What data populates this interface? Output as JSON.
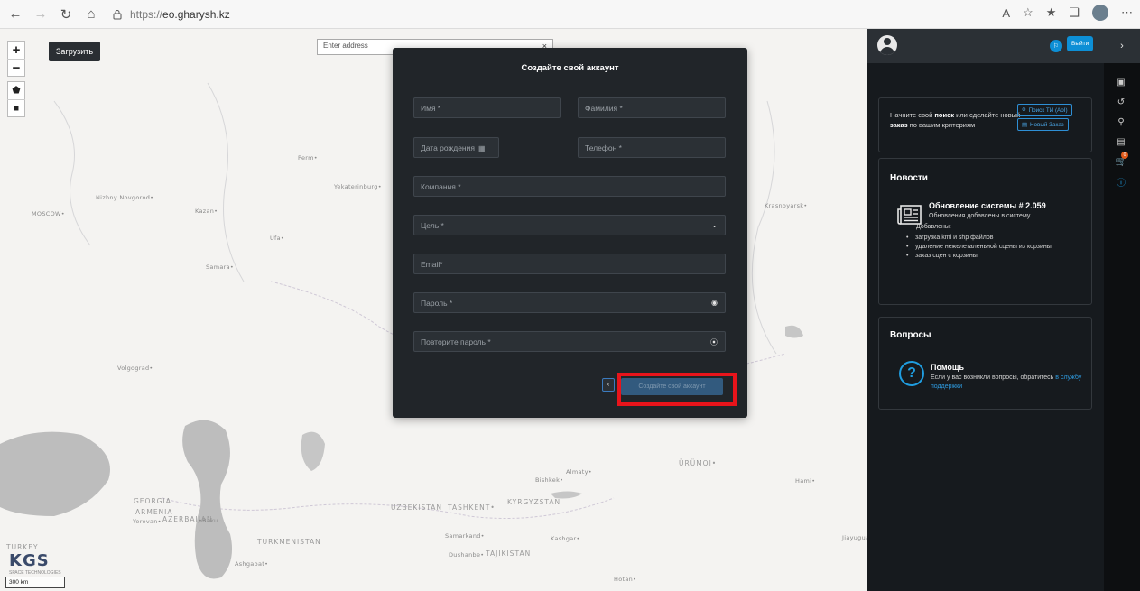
{
  "browser": {
    "url_scheme": "https://",
    "url_host": "eo.gharysh.kz"
  },
  "map": {
    "upload_label": "Загрузить",
    "address_placeholder": "Enter address",
    "scale_label": "300 km",
    "logo_text": "KGS",
    "logo_sub": "SPACE TECHNOLOGIES",
    "labels": {
      "moscow": "MOSCOW•",
      "nizhny": "Nizhny Novgorod•",
      "kazan": "Kazan•",
      "perm": "Perm•",
      "yekaterinburg": "Yekaterinburg•",
      "ufa": "Ufa•",
      "samara": "Samara•",
      "volgograd": "Volgograd•",
      "krasnoyarsk": "Krasnoyarsk•",
      "georgia": "GEORGIA",
      "armenia": "ARMENIA",
      "yerevan": "Yerevan•",
      "azerbaijan": "AZERBAIJAN",
      "baku": "•Baku",
      "turkey": "TURKEY",
      "turkmenistan": "TURKMENISTAN",
      "ashgabat": "Ashgabat•",
      "uzbekistan": "UZBEKISTAN",
      "tashkent": "TASHKENT•",
      "samarkand": "Samarkand•",
      "dushanbe": "Dushanbe•",
      "tajikistan": "TAJIKISTAN",
      "kyrgyzstan": "KYRGYZSTAN",
      "bishkek": "Bishkek•",
      "almaty": "Almaty•",
      "kashgar": "Kashgar•",
      "urumqi": "ÜRÜMQI•",
      "hami": "Hami•",
      "jiayuguan": "Jiayuguan",
      "hotan": "Hotan•"
    }
  },
  "modal": {
    "title": "Создайте свой аккаунт",
    "fields": {
      "first_name": "Имя *",
      "last_name": "Фамилия *",
      "birth_date": "Дата рождения",
      "phone": "Телефон *",
      "company": "Компания *",
      "purpose": "Цель *",
      "email": "Email*",
      "password": "Пароль *",
      "password_repeat": "Повторите пароль *"
    },
    "back_label": "‹",
    "submit_label": "Создайте свой аккаунт"
  },
  "panel": {
    "logout_label": "Выйти",
    "search_card": {
      "text_part1": "Начните свой ",
      "text_bold1": "поиск",
      "text_part2": " или сделайте новый ",
      "text_bold2": "заказ",
      "text_part3": " по вашим критериям",
      "search_btn": "Поиск ТИ (AoI)",
      "order_btn": "Новый Заказ"
    },
    "news": {
      "heading": "Новости",
      "title": "Обновление системы # 2.059",
      "subtitle": "Обновления добавлены в систему",
      "added": "Добавлены:",
      "items": [
        "загрузка kml и shp файлов",
        "удаление нежелеталеньной сцены из корзины",
        "заказ сцен с корзины"
      ]
    },
    "questions": {
      "heading": "Вопросы",
      "title": "Помощь",
      "text": "Если у вас возникли вопросы, обратитесь ",
      "link": "в службу поддержки"
    }
  },
  "strip": {
    "cart_count": "0"
  },
  "colors": {
    "accent": "#0d8fd6",
    "highlight": "#e8141b",
    "modal_bg": "#212529",
    "panel_bg": "#161a1e"
  }
}
